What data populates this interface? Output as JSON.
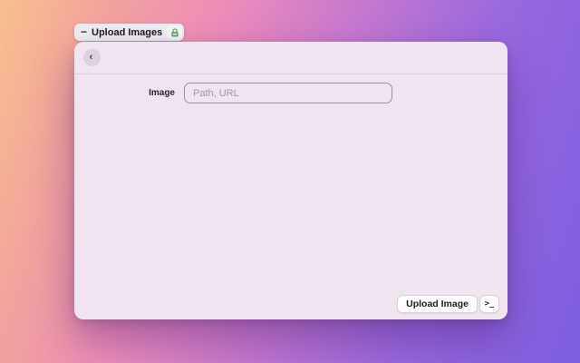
{
  "chip": {
    "minus_glyph": "−",
    "label": "Upload Images"
  },
  "window": {
    "back_glyph": "‹",
    "form": {
      "label": "Image",
      "input_value": "",
      "input_placeholder": "Path, URL"
    },
    "footer": {
      "upload_label": "Upload Image",
      "terminal_glyph": ">_"
    }
  },
  "colors": {
    "gradient_start": "#f8c08d",
    "gradient_pink": "#ee8db8",
    "gradient_end": "#7c5fe0",
    "panel_bg": "#f0e4f1",
    "chip_bg": "#efecf2",
    "lock_green": "#57a062",
    "input_border": "#96929c"
  }
}
